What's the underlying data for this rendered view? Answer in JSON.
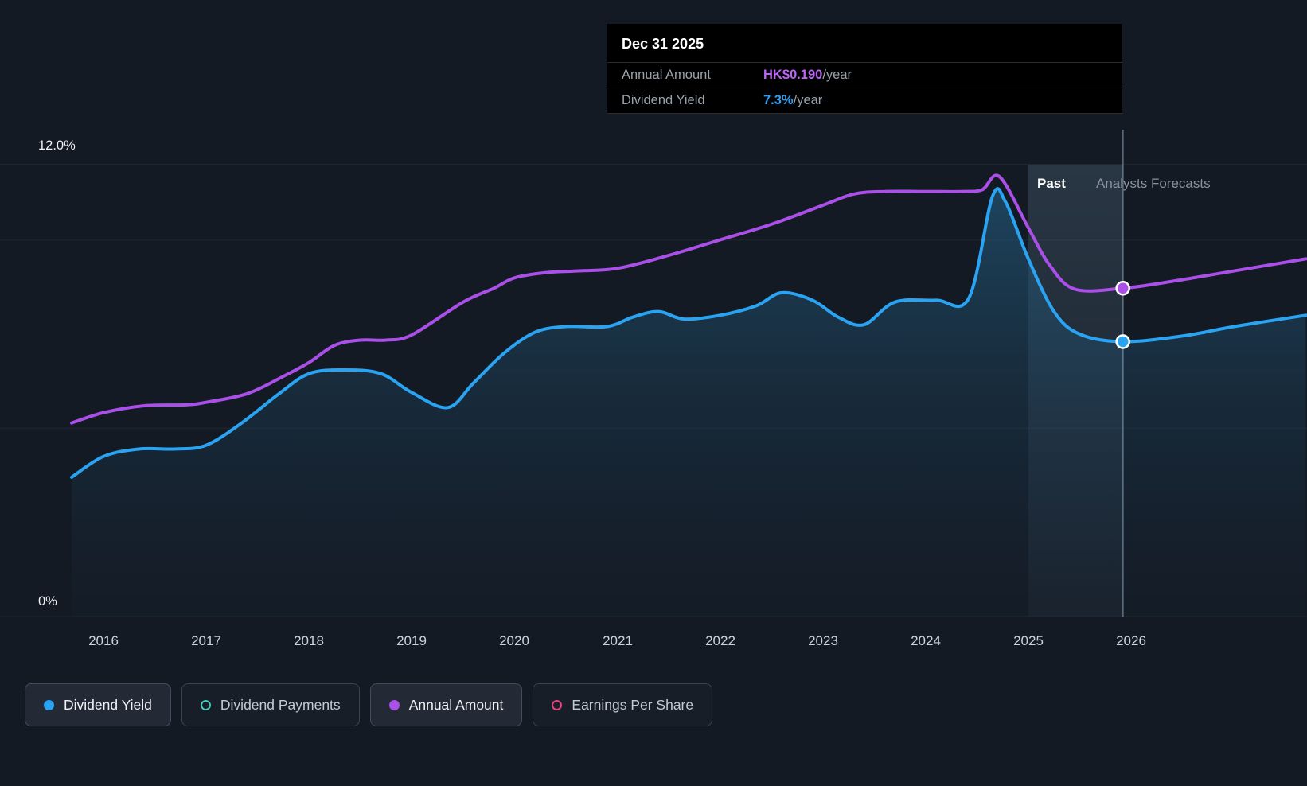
{
  "tooltip": {
    "date": "Dec 31 2025",
    "rows": [
      {
        "label": "Annual Amount",
        "value": "HK$0.190",
        "suffix": "/year",
        "color": "#bd66f5"
      },
      {
        "label": "Dividend Yield",
        "value": "7.3%",
        "suffix": "/year",
        "color": "#2e9ff2"
      }
    ]
  },
  "labels": {
    "past": "Past",
    "forecast": "Analysts Forecasts"
  },
  "y_axis_labels": [
    {
      "text": "12.0%"
    },
    {
      "text": "0%"
    }
  ],
  "legend": [
    {
      "label": "Dividend Yield",
      "color": "#2aa4f2",
      "style": "filled",
      "active": true
    },
    {
      "label": "Dividend Payments",
      "color": "#45c8bc",
      "style": "open",
      "active": false
    },
    {
      "label": "Annual Amount",
      "color": "#aa4fe8",
      "style": "filled",
      "active": true
    },
    {
      "label": "Earnings Per Share",
      "color": "#e8447e",
      "style": "open",
      "active": false
    }
  ],
  "chart_data": {
    "type": "area",
    "title": "Dividend history and forecast",
    "x_axis": {
      "ticks": [
        2016,
        2017,
        2018,
        2019,
        2020,
        2021,
        2022,
        2023,
        2024,
        2025,
        2026
      ],
      "range": [
        2015.69,
        2027.7
      ]
    },
    "y_axis": {
      "unit": "%",
      "range": [
        0,
        12
      ],
      "gridlines_pct": [
        12,
        10,
        5,
        0
      ]
    },
    "past_boundary_x": 2025.92,
    "highlight_band": {
      "from": 2025.0,
      "to": 2025.92
    },
    "series": [
      {
        "name": "Dividend Yield",
        "color": "#2aa4f2",
        "unit": "%",
        "axis_max": 12,
        "area": true,
        "points": [
          [
            2015.69,
            3.7
          ],
          [
            2016.0,
            4.25
          ],
          [
            2016.35,
            4.45
          ],
          [
            2016.7,
            4.45
          ],
          [
            2017.0,
            4.55
          ],
          [
            2017.35,
            5.15
          ],
          [
            2017.7,
            5.9
          ],
          [
            2018.0,
            6.45
          ],
          [
            2018.35,
            6.55
          ],
          [
            2018.7,
            6.45
          ],
          [
            2019.0,
            5.95
          ],
          [
            2019.35,
            5.55
          ],
          [
            2019.6,
            6.2
          ],
          [
            2019.9,
            7.0
          ],
          [
            2020.2,
            7.55
          ],
          [
            2020.5,
            7.7
          ],
          [
            2020.9,
            7.7
          ],
          [
            2021.15,
            7.95
          ],
          [
            2021.4,
            8.1
          ],
          [
            2021.65,
            7.9
          ],
          [
            2022.0,
            8.0
          ],
          [
            2022.35,
            8.25
          ],
          [
            2022.6,
            8.6
          ],
          [
            2022.9,
            8.4
          ],
          [
            2023.15,
            7.95
          ],
          [
            2023.4,
            7.75
          ],
          [
            2023.7,
            8.35
          ],
          [
            2024.1,
            8.4
          ],
          [
            2024.42,
            8.45
          ],
          [
            2024.65,
            11.15
          ],
          [
            2024.78,
            11.0
          ],
          [
            2025.0,
            9.5
          ],
          [
            2025.25,
            8.1
          ],
          [
            2025.5,
            7.5
          ],
          [
            2025.92,
            7.3
          ],
          [
            2026.5,
            7.45
          ],
          [
            2027.0,
            7.7
          ],
          [
            2027.7,
            8.0
          ]
        ]
      },
      {
        "name": "Annual Amount",
        "color": "#aa4fe8",
        "unit": "HK$",
        "axis_max": 0.2615,
        "points": [
          [
            2015.69,
            0.112
          ],
          [
            2016.0,
            0.118
          ],
          [
            2016.4,
            0.122
          ],
          [
            2016.8,
            0.1225
          ],
          [
            2017.0,
            0.124
          ],
          [
            2017.4,
            0.129
          ],
          [
            2017.75,
            0.139
          ],
          [
            2018.0,
            0.147
          ],
          [
            2018.25,
            0.157
          ],
          [
            2018.5,
            0.16
          ],
          [
            2018.75,
            0.16
          ],
          [
            2019.0,
            0.163
          ],
          [
            2019.5,
            0.182
          ],
          [
            2019.8,
            0.19
          ],
          [
            2020.0,
            0.196
          ],
          [
            2020.3,
            0.199
          ],
          [
            2020.6,
            0.2
          ],
          [
            2021.0,
            0.2015
          ],
          [
            2021.5,
            0.209
          ],
          [
            2022.0,
            0.218
          ],
          [
            2022.5,
            0.227
          ],
          [
            2023.0,
            0.238
          ],
          [
            2023.3,
            0.2445
          ],
          [
            2023.6,
            0.246
          ],
          [
            2024.0,
            0.246
          ],
          [
            2024.35,
            0.246
          ],
          [
            2024.55,
            0.247
          ],
          [
            2024.72,
            0.2545
          ],
          [
            2025.0,
            0.225
          ],
          [
            2025.2,
            0.204
          ],
          [
            2025.45,
            0.1895
          ],
          [
            2025.92,
            0.19
          ],
          [
            2026.4,
            0.194
          ],
          [
            2026.9,
            0.199
          ],
          [
            2027.7,
            0.207
          ]
        ]
      }
    ],
    "markers": [
      {
        "series": 0,
        "x": 2025.92,
        "value": 7.3,
        "label": "7.3%"
      },
      {
        "series": 1,
        "x": 2025.92,
        "value": 0.19,
        "label": "HK$0.190"
      }
    ]
  }
}
